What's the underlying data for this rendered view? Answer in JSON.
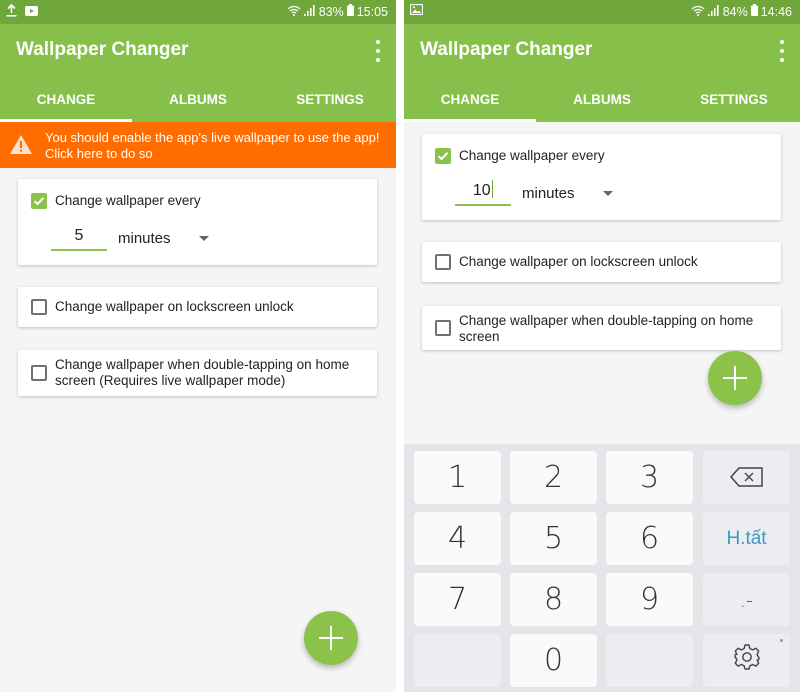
{
  "screens": [
    {
      "status": {
        "battery": "83%",
        "time": "15:05",
        "left_icons": [
          "upload-icon",
          "youtube-icon"
        ]
      },
      "app": {
        "title": "Wallpaper Changer"
      },
      "tabs": [
        {
          "label": "CHANGE",
          "active": true
        },
        {
          "label": "ALBUMS",
          "active": false
        },
        {
          "label": "SETTINGS",
          "active": false
        }
      ],
      "banner": {
        "text": "You should enable the app's live wallpaper to use the app! Click here to do so",
        "color": "#ff6d00"
      },
      "options": {
        "interval": {
          "label": "Change wallpaper every",
          "checked": true,
          "value": "5",
          "unit": "minutes"
        },
        "lockscreen": {
          "label": "Change wallpaper on lockscreen unlock",
          "checked": false
        },
        "doubletap": {
          "label": "Change wallpaper when double-tapping on home screen (Requires live wallpaper mode)",
          "checked": false
        }
      },
      "fab": {
        "icon": "plus-icon"
      }
    },
    {
      "status": {
        "battery": "84%",
        "time": "14:46",
        "left_icons": [
          "image-icon"
        ]
      },
      "app": {
        "title": "Wallpaper Changer"
      },
      "tabs": [
        {
          "label": "CHANGE",
          "active": true
        },
        {
          "label": "ALBUMS",
          "active": false
        },
        {
          "label": "SETTINGS",
          "active": false
        }
      ],
      "options": {
        "interval": {
          "label": "Change wallpaper every",
          "checked": true,
          "value": "10",
          "unit": "minutes"
        },
        "lockscreen": {
          "label": "Change wallpaper on lockscreen unlock",
          "checked": false
        },
        "doubletap": {
          "label": "Change wallpaper when double-tapping on home screen",
          "checked": false
        }
      },
      "fab": {
        "icon": "plus-icon"
      },
      "keyboard": {
        "keys": [
          "1",
          "2",
          "3",
          "4",
          "5",
          "6",
          "7",
          "8",
          "9",
          "0"
        ],
        "backspace_icon": "backspace-icon",
        "done_label": "H.tất",
        "punct_label": ".-",
        "settings_icon": "gear-icon"
      }
    }
  ],
  "colors": {
    "primary": "#86c04a",
    "primary_dark": "#6fa73a",
    "accent": "#8bc34a",
    "warning": "#ff6d00",
    "key_action_text": "#3d9ac4"
  }
}
